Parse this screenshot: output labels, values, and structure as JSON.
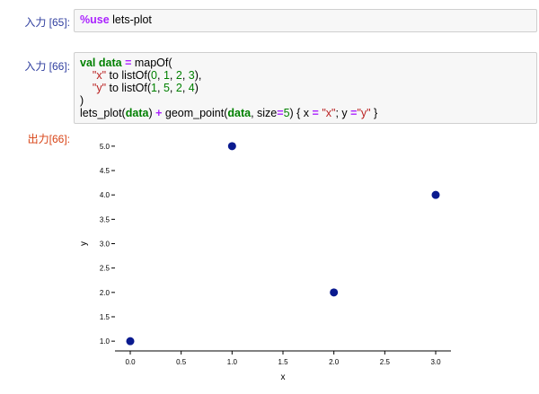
{
  "cells": [
    {
      "prompt": "入力 [65]:",
      "tokens": [
        {
          "t": "%use",
          "c": "mg"
        },
        {
          "t": " lets-plot",
          "c": ""
        }
      ]
    },
    {
      "prompt": "入力 [66]:",
      "tokens": [
        {
          "t": "val",
          "c": "kw"
        },
        {
          "t": " ",
          "c": ""
        },
        {
          "t": "data",
          "c": "kw"
        },
        {
          "t": " ",
          "c": ""
        },
        {
          "t": "=",
          "c": "op"
        },
        {
          "t": " mapOf(\n    ",
          "c": ""
        },
        {
          "t": "\"x\"",
          "c": "str"
        },
        {
          "t": " to listOf(",
          "c": ""
        },
        {
          "t": "0",
          "c": "num"
        },
        {
          "t": ", ",
          "c": ""
        },
        {
          "t": "1",
          "c": "num"
        },
        {
          "t": ", ",
          "c": ""
        },
        {
          "t": "2",
          "c": "num"
        },
        {
          "t": ", ",
          "c": ""
        },
        {
          "t": "3",
          "c": "num"
        },
        {
          "t": "),\n    ",
          "c": ""
        },
        {
          "t": "\"y\"",
          "c": "str"
        },
        {
          "t": " to listOf(",
          "c": ""
        },
        {
          "t": "1",
          "c": "num"
        },
        {
          "t": ", ",
          "c": ""
        },
        {
          "t": "5",
          "c": "num"
        },
        {
          "t": ", ",
          "c": ""
        },
        {
          "t": "2",
          "c": "num"
        },
        {
          "t": ", ",
          "c": ""
        },
        {
          "t": "4",
          "c": "num"
        },
        {
          "t": ")\n)\nlets_plot(",
          "c": ""
        },
        {
          "t": "data",
          "c": "kw"
        },
        {
          "t": ") ",
          "c": ""
        },
        {
          "t": "+",
          "c": "op"
        },
        {
          "t": " geom_point(",
          "c": ""
        },
        {
          "t": "data",
          "c": "kw"
        },
        {
          "t": ", size",
          "c": ""
        },
        {
          "t": "=",
          "c": "op"
        },
        {
          "t": "5",
          "c": "num"
        },
        {
          "t": ") { x ",
          "c": ""
        },
        {
          "t": "=",
          "c": "op"
        },
        {
          "t": " ",
          "c": ""
        },
        {
          "t": "\"x\"",
          "c": "str"
        },
        {
          "t": "; y ",
          "c": ""
        },
        {
          "t": "=",
          "c": "op"
        },
        {
          "t": "\"y\"",
          "c": "str"
        },
        {
          "t": " }",
          "c": ""
        }
      ]
    }
  ],
  "output_prompt": "出力[66]:",
  "chart_data": {
    "type": "scatter",
    "x": [
      0,
      1,
      2,
      3
    ],
    "y": [
      1,
      5,
      2,
      4
    ],
    "xlabel": "x",
    "ylabel": "y",
    "xlim": [
      -0.15,
      3.15
    ],
    "ylim": [
      0.8,
      5.2
    ],
    "x_ticks": [
      0.0,
      0.5,
      1.0,
      1.5,
      2.0,
      2.5,
      3.0
    ],
    "x_tick_labels": [
      "0.0",
      "0.5",
      "1.0",
      "1.5",
      "2.0",
      "2.5",
      "3.0"
    ],
    "y_ticks": [
      1.0,
      1.5,
      2.0,
      2.5,
      3.0,
      3.5,
      4.0,
      4.5,
      5.0
    ],
    "y_tick_labels": [
      "1.0",
      "1.5",
      "2.0",
      "2.5",
      "3.0",
      "3.5",
      "4.0",
      "4.5",
      "5.0"
    ],
    "point_color": "#0a1a8f",
    "grid": false
  },
  "colors": {
    "prompt_in": "#303f9f",
    "prompt_out": "#d84315",
    "keyword": "#008000",
    "string": "#ba2121",
    "operator": "#aa22ff"
  }
}
